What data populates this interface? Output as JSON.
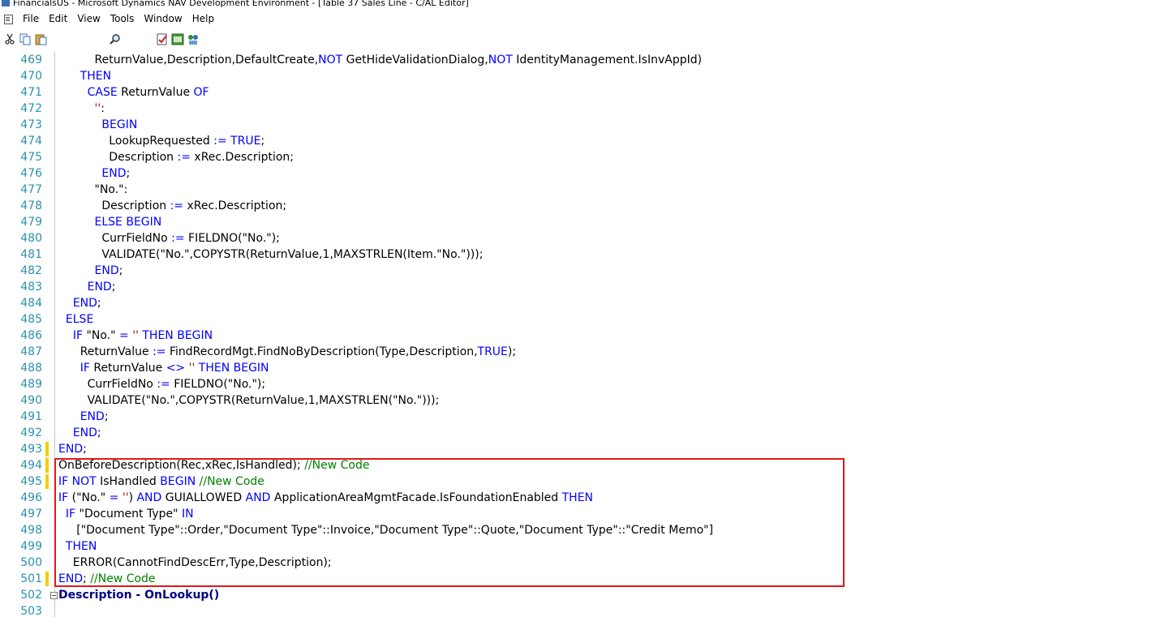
{
  "window": {
    "title": "FinancialsUS - Microsoft Dynamics NAV Development Environment - [Table 37 Sales Line - C/AL Editor]"
  },
  "menu": [
    "File",
    "Edit",
    "View",
    "Tools",
    "Window",
    "Help"
  ],
  "toolbar": {
    "icons": [
      "cut-icon",
      "copy-icon",
      "paste-icon",
      "find-icon",
      "compile-icon",
      "run-icon",
      "debug-icon"
    ]
  },
  "editor": {
    "lines": [
      {
        "n": "469",
        "segments": [
          [
            "          ReturnValue,Description,DefaultCreate,",
            ""
          ],
          [
            "NOT",
            "kw"
          ],
          [
            " GetHideValidationDialog,",
            ""
          ],
          [
            "NOT",
            "kw"
          ],
          [
            " IdentityManagement.IsInvAppId)",
            ""
          ]
        ]
      },
      {
        "n": "470",
        "segments": [
          [
            "      ",
            ""
          ],
          [
            "THEN",
            "kw"
          ]
        ]
      },
      {
        "n": "471",
        "segments": [
          [
            "        ",
            ""
          ],
          [
            "CASE",
            "kw"
          ],
          [
            " ReturnValue ",
            ""
          ],
          [
            "OF",
            "kw"
          ]
        ]
      },
      {
        "n": "472",
        "segments": [
          [
            "          ",
            ""
          ],
          [
            "''",
            "str"
          ],
          [
            ":",
            ""
          ]
        ]
      },
      {
        "n": "473",
        "segments": [
          [
            "            ",
            ""
          ],
          [
            "BEGIN",
            "kw"
          ]
        ]
      },
      {
        "n": "474",
        "segments": [
          [
            "              LookupRequested ",
            ""
          ],
          [
            ":=",
            "kw"
          ],
          [
            " ",
            ""
          ],
          [
            "TRUE",
            "kw"
          ],
          [
            ";",
            ""
          ]
        ]
      },
      {
        "n": "475",
        "segments": [
          [
            "              Description ",
            ""
          ],
          [
            ":=",
            "kw"
          ],
          [
            " xRec.Description;",
            ""
          ]
        ]
      },
      {
        "n": "476",
        "segments": [
          [
            "            ",
            ""
          ],
          [
            "END",
            "kw"
          ],
          [
            ";",
            ""
          ]
        ]
      },
      {
        "n": "477",
        "segments": [
          [
            "          \"No.\":",
            ""
          ]
        ]
      },
      {
        "n": "478",
        "segments": [
          [
            "            Description ",
            ""
          ],
          [
            ":=",
            "kw"
          ],
          [
            " xRec.Description;",
            ""
          ]
        ]
      },
      {
        "n": "479",
        "segments": [
          [
            "          ",
            ""
          ],
          [
            "ELSE BEGIN",
            "kw"
          ]
        ]
      },
      {
        "n": "480",
        "segments": [
          [
            "            CurrFieldNo ",
            ""
          ],
          [
            ":=",
            "kw"
          ],
          [
            " FIELDNO(\"No.\");",
            ""
          ]
        ]
      },
      {
        "n": "481",
        "segments": [
          [
            "            VALIDATE(\"No.\",COPYSTR(ReturnValue,",
            ""
          ],
          [
            "1",
            "num"
          ],
          [
            ",MAXSTRLEN(Item.\"No.\")));",
            ""
          ]
        ]
      },
      {
        "n": "482",
        "segments": [
          [
            "          ",
            ""
          ],
          [
            "END",
            "kw"
          ],
          [
            ";",
            ""
          ]
        ]
      },
      {
        "n": "483",
        "segments": [
          [
            "        ",
            ""
          ],
          [
            "END",
            "kw"
          ],
          [
            ";",
            ""
          ]
        ]
      },
      {
        "n": "484",
        "segments": [
          [
            "    ",
            ""
          ],
          [
            "END",
            "kw"
          ],
          [
            ";",
            ""
          ]
        ]
      },
      {
        "n": "485",
        "segments": [
          [
            "  ",
            ""
          ],
          [
            "ELSE",
            "kw"
          ]
        ]
      },
      {
        "n": "486",
        "segments": [
          [
            "    ",
            ""
          ],
          [
            "IF",
            "kw"
          ],
          [
            " \"No.\" ",
            ""
          ],
          [
            "=",
            "kw"
          ],
          [
            " ",
            ""
          ],
          [
            "''",
            "str"
          ],
          [
            " ",
            ""
          ],
          [
            "THEN BEGIN",
            "kw"
          ]
        ]
      },
      {
        "n": "487",
        "segments": [
          [
            "      ReturnValue ",
            ""
          ],
          [
            ":=",
            "kw"
          ],
          [
            " FindRecordMgt.FindNoByDescription(Type,Description,",
            ""
          ],
          [
            "TRUE",
            "kw"
          ],
          [
            ");",
            ""
          ]
        ]
      },
      {
        "n": "488",
        "segments": [
          [
            "      ",
            ""
          ],
          [
            "IF",
            "kw"
          ],
          [
            " ReturnValue ",
            ""
          ],
          [
            "<>",
            "kw"
          ],
          [
            " ",
            ""
          ],
          [
            "''",
            "str"
          ],
          [
            " ",
            ""
          ],
          [
            "THEN BEGIN",
            "kw"
          ]
        ]
      },
      {
        "n": "489",
        "segments": [
          [
            "        CurrFieldNo ",
            ""
          ],
          [
            ":=",
            "kw"
          ],
          [
            " FIELDNO(\"No.\");",
            ""
          ]
        ]
      },
      {
        "n": "490",
        "segments": [
          [
            "        VALIDATE(\"No.\",COPYSTR(ReturnValue,",
            ""
          ],
          [
            "1",
            "num"
          ],
          [
            ",MAXSTRLEN(\"No.\")));",
            ""
          ]
        ]
      },
      {
        "n": "491",
        "segments": [
          [
            "      ",
            ""
          ],
          [
            "END",
            "kw"
          ],
          [
            ";",
            ""
          ]
        ]
      },
      {
        "n": "492",
        "segments": [
          [
            "    ",
            ""
          ],
          [
            "END",
            "kw"
          ],
          [
            ";",
            ""
          ]
        ]
      },
      {
        "n": "493",
        "segments": [
          [
            "",
            ""
          ],
          [
            "END",
            "kw"
          ],
          [
            ";",
            ""
          ]
        ],
        "mark": true
      },
      {
        "n": "494",
        "segments": [
          [
            "OnBeforeDescription(Rec,xRec,IsHandled); ",
            ""
          ],
          [
            "//New Code",
            "cm"
          ]
        ],
        "mark": true
      },
      {
        "n": "495",
        "segments": [
          [
            "",
            ""
          ],
          [
            "IF NOT",
            "kw"
          ],
          [
            " IsHandled ",
            ""
          ],
          [
            "BEGIN",
            "kw"
          ],
          [
            " ",
            ""
          ],
          [
            "//New Code",
            "cm"
          ]
        ],
        "mark": true
      },
      {
        "n": "496",
        "segments": [
          [
            "",
            ""
          ],
          [
            "IF",
            "kw"
          ],
          [
            " (\"No.\" ",
            ""
          ],
          [
            "=",
            "kw"
          ],
          [
            " ",
            ""
          ],
          [
            "''",
            "str"
          ],
          [
            ") ",
            ""
          ],
          [
            "AND",
            "kw"
          ],
          [
            " GUIALLOWED ",
            ""
          ],
          [
            "AND",
            "kw"
          ],
          [
            " ApplicationAreaMgmtFacade.IsFoundationEnabled ",
            ""
          ],
          [
            "THEN",
            "kw"
          ]
        ]
      },
      {
        "n": "497",
        "segments": [
          [
            "  ",
            ""
          ],
          [
            "IF",
            "kw"
          ],
          [
            " \"Document Type\" ",
            ""
          ],
          [
            "IN",
            "kw"
          ]
        ]
      },
      {
        "n": "498",
        "segments": [
          [
            "     [\"Document Type\"::Order,\"Document Type\"::Invoice,\"Document Type\"::Quote,\"Document Type\"::\"Credit Memo\"]",
            ""
          ]
        ]
      },
      {
        "n": "499",
        "segments": [
          [
            "  ",
            ""
          ],
          [
            "THEN",
            "kw"
          ]
        ]
      },
      {
        "n": "500",
        "segments": [
          [
            "    ERROR(CannotFindDescErr,Type,Description);",
            ""
          ]
        ]
      },
      {
        "n": "501",
        "segments": [
          [
            "",
            ""
          ],
          [
            "END",
            "kw"
          ],
          [
            "; ",
            ""
          ],
          [
            "//New Code",
            "cm"
          ]
        ],
        "mark": true
      },
      {
        "n": "502",
        "segments": [
          [
            "Description - OnLookup()",
            "bold"
          ]
        ],
        "fold": true
      },
      {
        "n": "503",
        "segments": [
          [
            "",
            ""
          ]
        ]
      }
    ]
  },
  "colors": {
    "keyword": "#0000ff",
    "comment": "#008000",
    "line_number": "#2b91af",
    "highlight_border": "#e01818",
    "change_marker": "#f2d000"
  }
}
